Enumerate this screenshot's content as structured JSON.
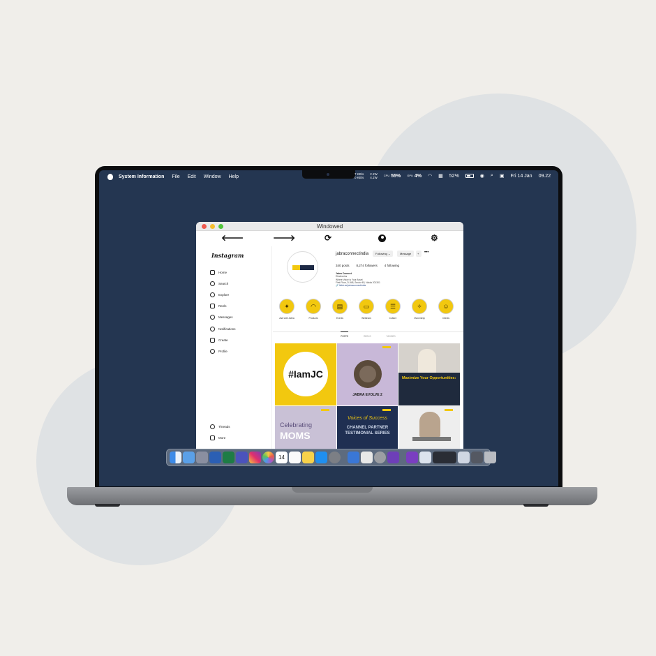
{
  "menubar": {
    "app_name": "System Information",
    "menus": [
      "File",
      "Edit",
      "Window",
      "Help"
    ],
    "net_up": "7 KB/s",
    "net_down": "0 KB/s",
    "power_a": "2.1W",
    "power_b": "4.1W",
    "cpu_label": "CPU",
    "cpu": "55%",
    "gpu_label": "GPU",
    "gpu": "4%",
    "battery": "52%",
    "date": "Fri 14 Jan",
    "time": "09.22"
  },
  "window": {
    "title": "Windowed"
  },
  "toolbar": {
    "back": "🡐",
    "forward": "🡒",
    "reload": "⟳",
    "settings": "⚙"
  },
  "instagram": {
    "logo": "Instagram",
    "nav": [
      "Home",
      "Search",
      "Explore",
      "Reels",
      "Messages",
      "Notifications",
      "Create",
      "Profile"
    ],
    "nav_bottom": [
      "Threads",
      "More"
    ],
    "username": "jabraconnectindia",
    "following_btn": "Following ⌄",
    "message_btn": "Message",
    "add_btn": "+",
    "more": "•••",
    "posts": "340 posts",
    "followers": "8,274 followers",
    "following": "4 following",
    "bio_name": "Jabra Connect",
    "bio_lines": [
      "Electronics",
      "Where Voice is Your Asset",
      "First Floor, D-948, Sector 63, Noida 201301"
    ],
    "bio_link": "🔗 linktr.ee/jabraconnectindia",
    "highlights": [
      "Ask with Jabra",
      "Products",
      "Events",
      "Webinars",
      "Culture",
      "Ownership",
      "Clients"
    ],
    "tabs": [
      "POSTS",
      "REELS",
      "TAGGED"
    ],
    "grid": {
      "p1": "#IamJC",
      "p2": "JABRA EVOLVE 2",
      "p3": "Maximize Your Opportunities:",
      "p4_a": "Celebrating",
      "p4_b": "MOMS",
      "p5_a": "Voices of Success",
      "p5_b": "CHANNEL PARTNER TESTIMONIAL SERIES"
    }
  },
  "dock": {
    "icons": [
      "finder-icon",
      "music-icon",
      "launchpad-icon",
      "word-icon",
      "excel-icon",
      "teams-icon",
      "instagram-icon",
      "photos-icon",
      "calendar-icon",
      "reminders-icon",
      "notes-icon",
      "appstore-icon",
      "settings-icon",
      "xcode-icon",
      "preview-icon",
      "disk-utility-icon",
      "github-icon",
      "github-desktop-icon",
      "finder-window-icon",
      "finder-window-icon-2",
      "app-window-icon",
      "trash-icon"
    ],
    "calendar_day": "14"
  }
}
